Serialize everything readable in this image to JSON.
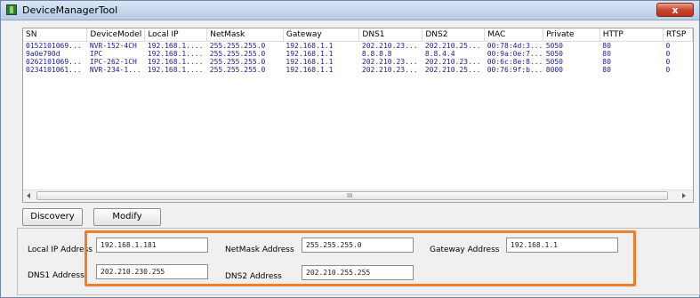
{
  "window": {
    "title": "DeviceManagerTool",
    "close_label": "x"
  },
  "table": {
    "columns": [
      "SN",
      "DeviceModel",
      "Local IP",
      "NetMask",
      "Gateway",
      "DNS1",
      "DNS2",
      "MAC",
      "Private",
      "HTTP",
      "RTSP"
    ],
    "rows": [
      [
        "0152101069...",
        "NVR-152-4CH",
        "192.168.1....",
        "255.255.255.0",
        "192.168.1.1",
        "202.210.23...",
        "202.210.25...",
        "00:78:4d:3...",
        "5050",
        "80",
        "0"
      ],
      [
        "9a0e790d",
        "IPC",
        "192.168.1....",
        "255.255.255.0",
        "192.168.1.1",
        "8.8.8.8",
        "8.8.4.4",
        "00:9a:0e:7...",
        "5050",
        "80",
        "0"
      ],
      [
        "0262101069...",
        "IPC-262-1CH",
        "192.168.1....",
        "255.255.255.0",
        "192.168.1.1",
        "202.210.23...",
        "202.210.23...",
        "00:6c:8e:8...",
        "5050",
        "80",
        "0"
      ],
      [
        "0234101061...",
        "NVR-234-1...",
        "192.168.1....",
        "255.255.255.0",
        "192.168.1.1",
        "202.210.23...",
        "202.210.25...",
        "00:76:9f:b...",
        "8000",
        "80",
        "0"
      ]
    ],
    "scroll_grip": "III"
  },
  "buttons": {
    "discovery": "Discovery",
    "modify": "Modify"
  },
  "form": {
    "local_ip_label": "Local IP Address",
    "local_ip_value": "192.168.1.181",
    "netmask_label": "NetMask Address",
    "netmask_value": "255.255.255.0",
    "gateway_label": "Gateway Address",
    "gateway_value": "192.168.1.1",
    "dns1_label": "DNS1 Address",
    "dns1_value": "202.210.230.255",
    "dns2_label": "DNS2 Address",
    "dns2_value": "202.210.255.255"
  },
  "colors": {
    "highlight_border": "#ee7f2a",
    "row_text": "#1a1a9c"
  }
}
